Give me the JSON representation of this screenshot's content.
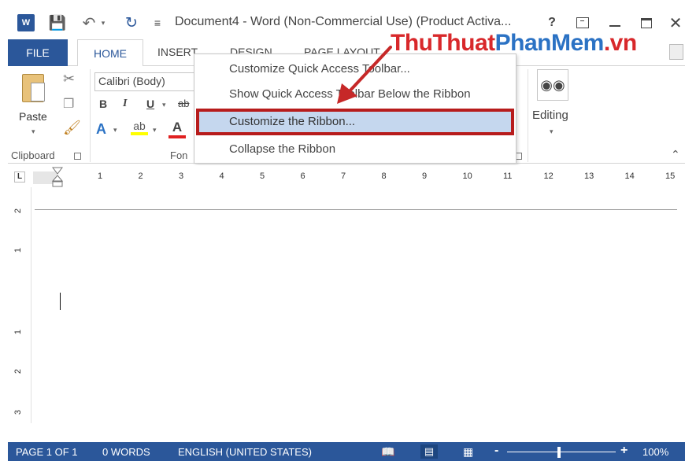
{
  "titlebar": {
    "word_icon": "W",
    "title": "Document4 - Word (Non-Commercial Use) (Product Activa...",
    "help": "?",
    "close": "✕",
    "icons": [
      "word-app-icon",
      "save-icon",
      "undo-icon",
      "redo-icon",
      "customize-qat-icon",
      "ribbon-display-options-icon",
      "minimize-icon",
      "maximize-icon",
      "close-icon"
    ]
  },
  "tabs": {
    "file": "FILE",
    "home": "HOME",
    "insert": "INSERT",
    "design": "DESIGN",
    "page_layout": "PAGE LAYOUT"
  },
  "watermark": {
    "part1": "ThuThuat",
    "part2": "PhanMem",
    "part3": ".vn"
  },
  "ribbon": {
    "clipboard": {
      "paste_label": "Paste",
      "group_label": "Clipboard"
    },
    "font": {
      "font_name": "Calibri (Body)",
      "bold": "B",
      "italic": "I",
      "underline": "U",
      "strike": "ab",
      "text_effects": "A",
      "highlight": "ab",
      "font_color": "A",
      "group_label": "Fon"
    },
    "editing": {
      "label": "Editing"
    }
  },
  "context_menu": {
    "items": [
      "Customize Quick Access Toolbar...",
      "Show Quick Access Toolbar Below the Ribbon",
      "Customize the Ribbon...",
      "Collapse the Ribbon"
    ],
    "highlighted_index": 2
  },
  "ruler": {
    "tab_selector": "L",
    "numbers": [
      "1",
      "2",
      "3",
      "4",
      "5",
      "6",
      "7",
      "8",
      "9",
      "10",
      "11",
      "12",
      "13",
      "14",
      "15"
    ],
    "vertical_numbers": [
      "2",
      "1",
      "1",
      "2",
      "3"
    ]
  },
  "statusbar": {
    "page": "PAGE 1 OF 1",
    "words": "0 WORDS",
    "language": "ENGLISH (UNITED STATES)",
    "zoom_out": "-",
    "zoom_in": "+",
    "zoom_level": "100%",
    "zoom_fraction": 0.5
  },
  "colors": {
    "word_blue": "#2b579a",
    "highlight_box": "#b71c1c",
    "menu_hover": "#c5d7ee",
    "watermark_red": "#d8282b",
    "watermark_blue": "#2b72c4"
  }
}
